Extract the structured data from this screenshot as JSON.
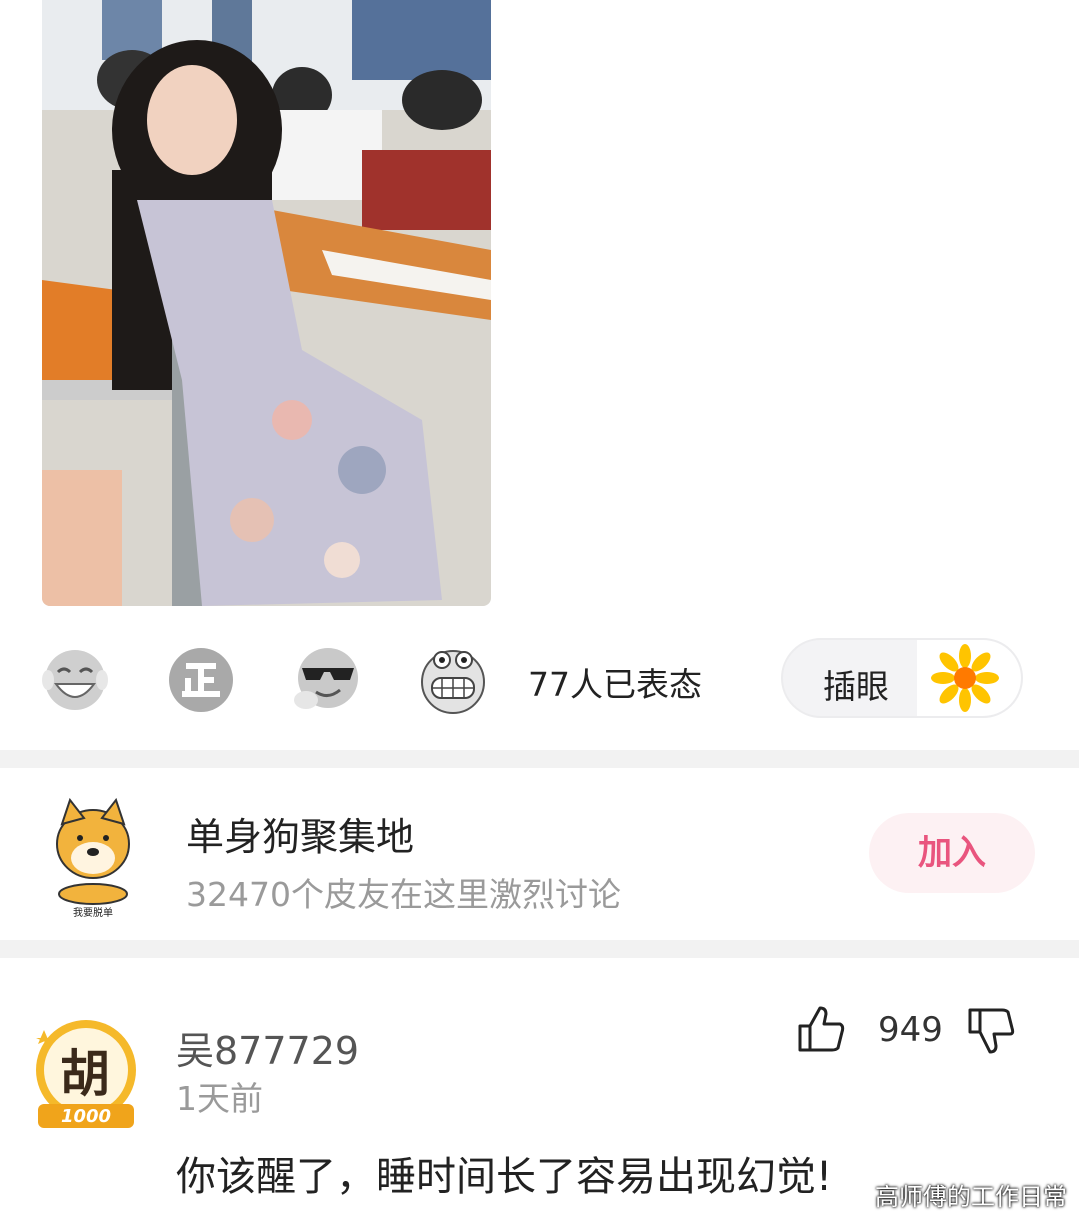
{
  "post": {
    "photo": {
      "alt": "photo-classroom"
    }
  },
  "reactions": {
    "emojis": [
      {
        "icon": "laughing-tears-emoji-icon"
      },
      {
        "icon": "correct-zheng-emoji-icon"
      },
      {
        "icon": "sunglasses-cool-emoji-icon"
      },
      {
        "icon": "grinning-teeth-emoji-icon"
      }
    ],
    "count_text": "77人已表态",
    "peek_button": {
      "label": "插眼",
      "icon": "sunflower-icon"
    }
  },
  "group": {
    "name": "单身狗聚集地",
    "description": "32470个皮友在这里激烈讨论",
    "avatar_caption": "我要脱单",
    "join_label": "加入",
    "accent": "#e9557e"
  },
  "comment": {
    "username": "吴877729",
    "time": "1天前",
    "avatar_char": "胡",
    "avatar_badge": "1000天",
    "likes": "949",
    "text": "你该醒了，睡时间长了容易出现幻觉!"
  },
  "watermark": "高师傅的工作日常"
}
